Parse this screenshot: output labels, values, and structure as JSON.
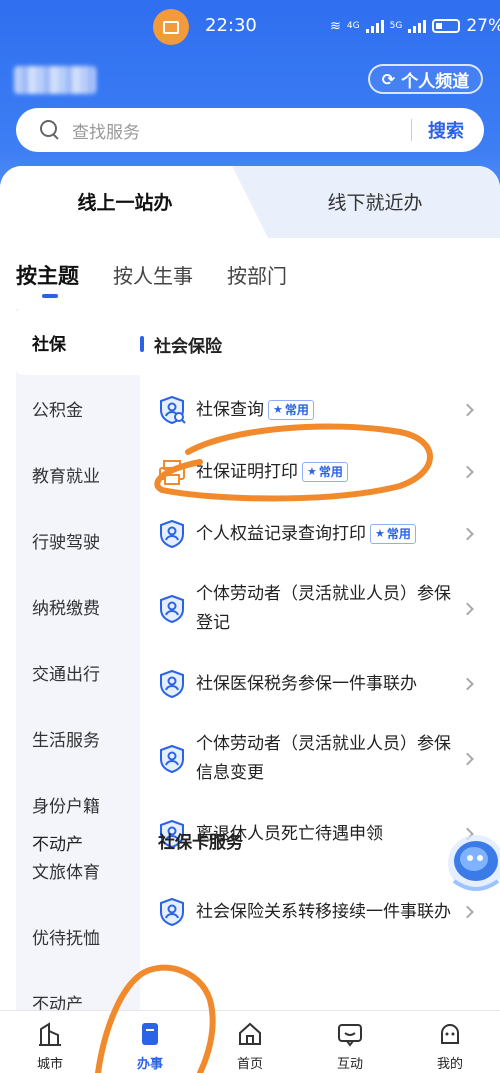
{
  "status_bar": {
    "time": "22:30",
    "network_1": "4G",
    "network_2": "5G",
    "battery": "27%"
  },
  "header": {
    "channel_button": "个人频道"
  },
  "search": {
    "placeholder": "查找服务",
    "button": "搜索"
  },
  "top_tabs": {
    "online": "线上一站办",
    "offline": "线下就近办"
  },
  "category_tabs": [
    "按主题",
    "按人生事",
    "按部门"
  ],
  "sidebar": {
    "items": [
      {
        "label": "社保",
        "active": true
      },
      {
        "label": "公积金"
      },
      {
        "label": "教育就业"
      },
      {
        "label": "行驶驾驶"
      },
      {
        "label": "纳税缴费"
      },
      {
        "label": "交通出行"
      },
      {
        "label": "生活服务"
      },
      {
        "label": "身份户籍"
      },
      {
        "label": "文旅体育"
      },
      {
        "label": "优待抚恤"
      },
      {
        "label": "不动产"
      }
    ]
  },
  "content": {
    "group_title": "社会保险",
    "tag_label": "常用",
    "services": [
      {
        "label": "社保查询",
        "common": true,
        "icon": "shield-search-icon"
      },
      {
        "label": "社保证明打印",
        "common": true,
        "icon": "printer-icon"
      },
      {
        "label": "个人权益记录查询打印",
        "common": true,
        "icon": "shield-person-icon"
      },
      {
        "label": "个体劳动者（灵活就业人员）参保登记",
        "common": false,
        "icon": "shield-person-icon"
      },
      {
        "label": "社保医保税务参保一件事联办",
        "common": false,
        "icon": "shield-person-icon"
      },
      {
        "label": "个体劳动者（灵活就业人员）参保信息变更",
        "common": false,
        "icon": "shield-person-icon"
      },
      {
        "label": "离退休人员死亡待遇申领",
        "common": false,
        "icon": "shield-person-icon"
      },
      {
        "label": "社会保险关系转移接续一件事联办",
        "common": false,
        "icon": "shield-person-icon"
      }
    ],
    "next_group_partial": "社保卡服务"
  },
  "tab_bar": [
    {
      "label": "城市",
      "icon": "city-icon"
    },
    {
      "label": "办事",
      "icon": "affairs-icon",
      "active": true
    },
    {
      "label": "首页",
      "icon": "home-icon"
    },
    {
      "label": "互动",
      "icon": "chat-icon"
    },
    {
      "label": "我的",
      "icon": "profile-icon"
    }
  ],
  "colors": {
    "brand_blue": "#2b63e6",
    "annotation_orange": "#f08a2c"
  }
}
